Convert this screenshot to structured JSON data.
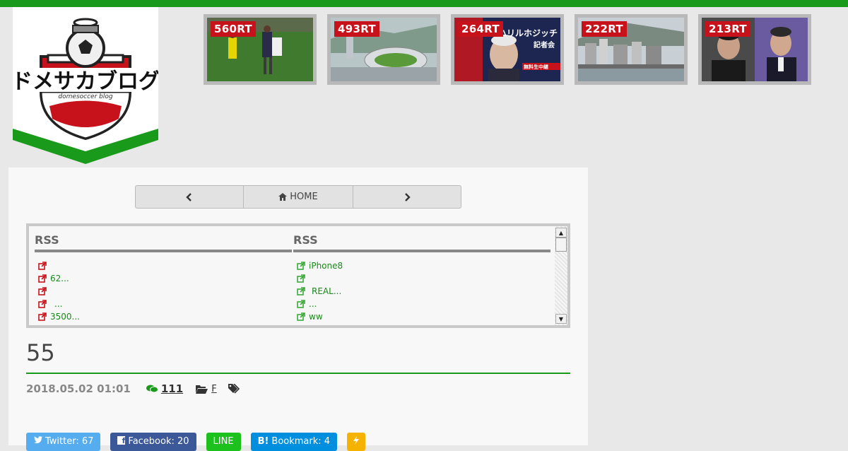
{
  "colors": {
    "accent_green": "#1a9a1a",
    "badge_red": "#c8121b"
  },
  "logo": {
    "alt_text": "ドメサカブログ",
    "subtitle": "domesoccer blog"
  },
  "ranking": [
    {
      "count": "560RT",
      "image": "soccer-match-photo"
    },
    {
      "count": "493RT",
      "image": "stadium-rendering"
    },
    {
      "count": "264RT",
      "image": "press-conference-photo",
      "overlay_text": "ハリルホジッチ",
      "overlay_sub": "記者会",
      "live_label": "無料生中継"
    },
    {
      "count": "222RT",
      "image": "city-waterfront-photo"
    },
    {
      "count": "213RT",
      "image": "coaches-photo"
    }
  ],
  "nav": {
    "prev_icon": "chevron-left",
    "home_label": "HOME",
    "next_icon": "chevron-right"
  },
  "rss": {
    "left": {
      "header": "RSS",
      "items": [
        "",
        "62...",
        "",
        "...",
        "3500..."
      ]
    },
    "right": {
      "header": "RSS",
      "items": [
        "iPhone8",
        "",
        "REAL...",
        "...",
        "ww"
      ]
    }
  },
  "article": {
    "title": "55",
    "date": "2018.05.02 01:01",
    "comments": "111",
    "category": "F"
  },
  "share": {
    "twitter": "Twitter: 67",
    "facebook": "Facebook: 20",
    "line": "LINE",
    "hatena_icon": "B!",
    "hatena": "Bookmark: 4"
  }
}
